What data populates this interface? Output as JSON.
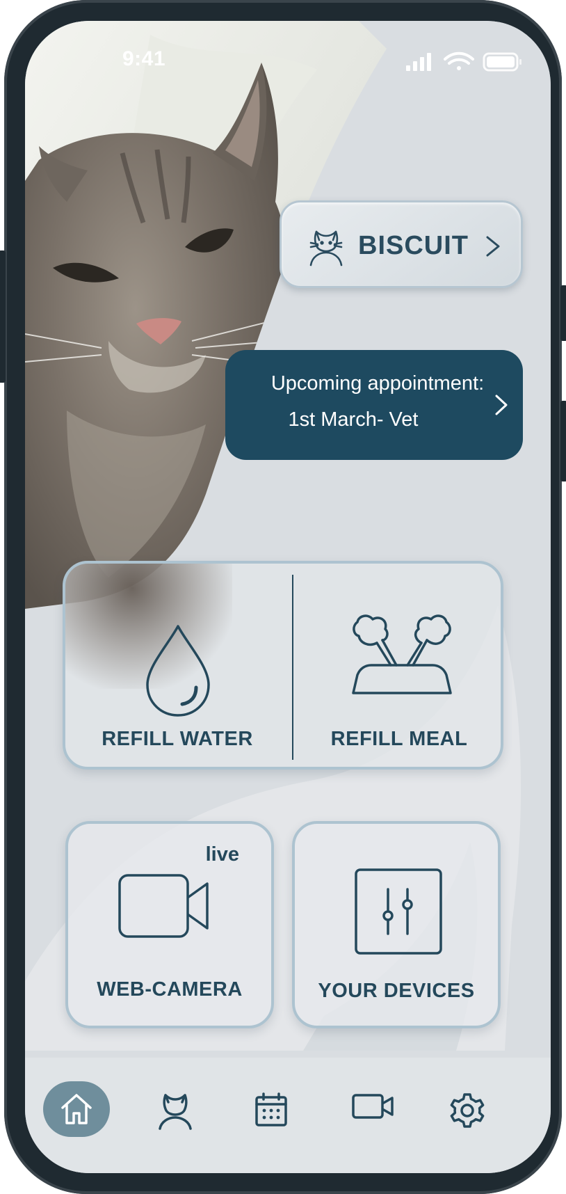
{
  "status_bar": {
    "time": "9:41"
  },
  "pet": {
    "name": "BISCUIT",
    "icon": "cat-face-icon"
  },
  "appointment": {
    "title": "Upcoming appointment:",
    "detail": "1st March- Vet"
  },
  "actions": {
    "refill_water": {
      "label": "REFILL WATER",
      "icon": "water-drop-icon"
    },
    "refill_meal": {
      "label": "REFILL MEAL",
      "icon": "food-bowl-icon"
    },
    "web_camera": {
      "label": "WEB-CAMERA",
      "badge": "live",
      "icon": "video-camera-icon"
    },
    "your_devices": {
      "label": "YOUR DEVICES",
      "icon": "sliders-icon"
    }
  },
  "bottom_nav": {
    "active": "home",
    "items": [
      "home-icon",
      "cat-profile-icon",
      "calendar-icon",
      "video-camera-icon",
      "gear-icon"
    ]
  },
  "colors": {
    "primary": "#1e4a60",
    "text": "#24485b",
    "card_border": "#adc3d0",
    "background": "#dadde1",
    "active_nav": "#6f8e9c"
  }
}
